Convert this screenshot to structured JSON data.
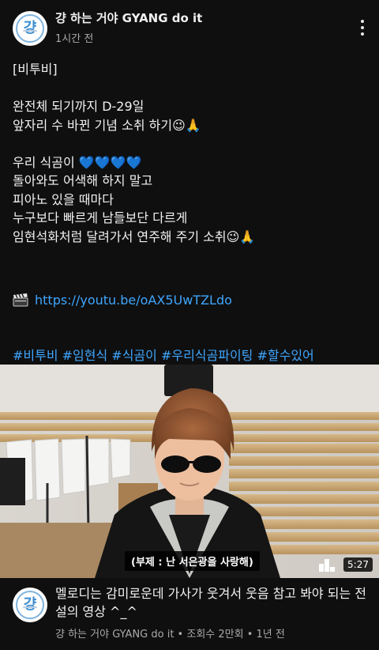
{
  "header": {
    "channel_name": "걍 하는 거야 GYANG do it",
    "posted": "1시간 전",
    "avatar_glyph": "걍"
  },
  "post": {
    "lines_a": [
      "[비투비]"
    ],
    "lines_b": [
      "완전체 되기까지 D-29일",
      "앞자리 수 바뀐 기념 소취 하기"
    ],
    "line_c1": "우리 식곰이",
    "hearts": "💙💙💙💙",
    "lines_c": [
      "돌아와도 어색해 하지 말고",
      "피아노 있을 때마다",
      "누구보다 빠르게 남들보단 다르게",
      "임현석화처럼 달려가서 연주해 주기 소취"
    ],
    "wink_emoji": "😉",
    "link_icon": "clapperboard-icon",
    "link": "https://youtu.be/oAX5UwTZLdo",
    "hashtags": "#비투비 #임현식 #식곰이 #우리식곰파이팅 #할수있어"
  },
  "video": {
    "caption": "(부제 : 난 서은광을 사랑해)",
    "duration": "5:27",
    "title": "멜로디는 감미로운데 가사가 웃겨서 웃음 참고 봐야 되는 전설의 영상 ^_^",
    "meta": "걍 하는 거야 GYANG do it • 조회수 2만회 • 1년 전"
  },
  "colors": {
    "background": "#0f0f0f",
    "link": "#3ea6ff",
    "secondary_text": "#aaaaaa"
  }
}
